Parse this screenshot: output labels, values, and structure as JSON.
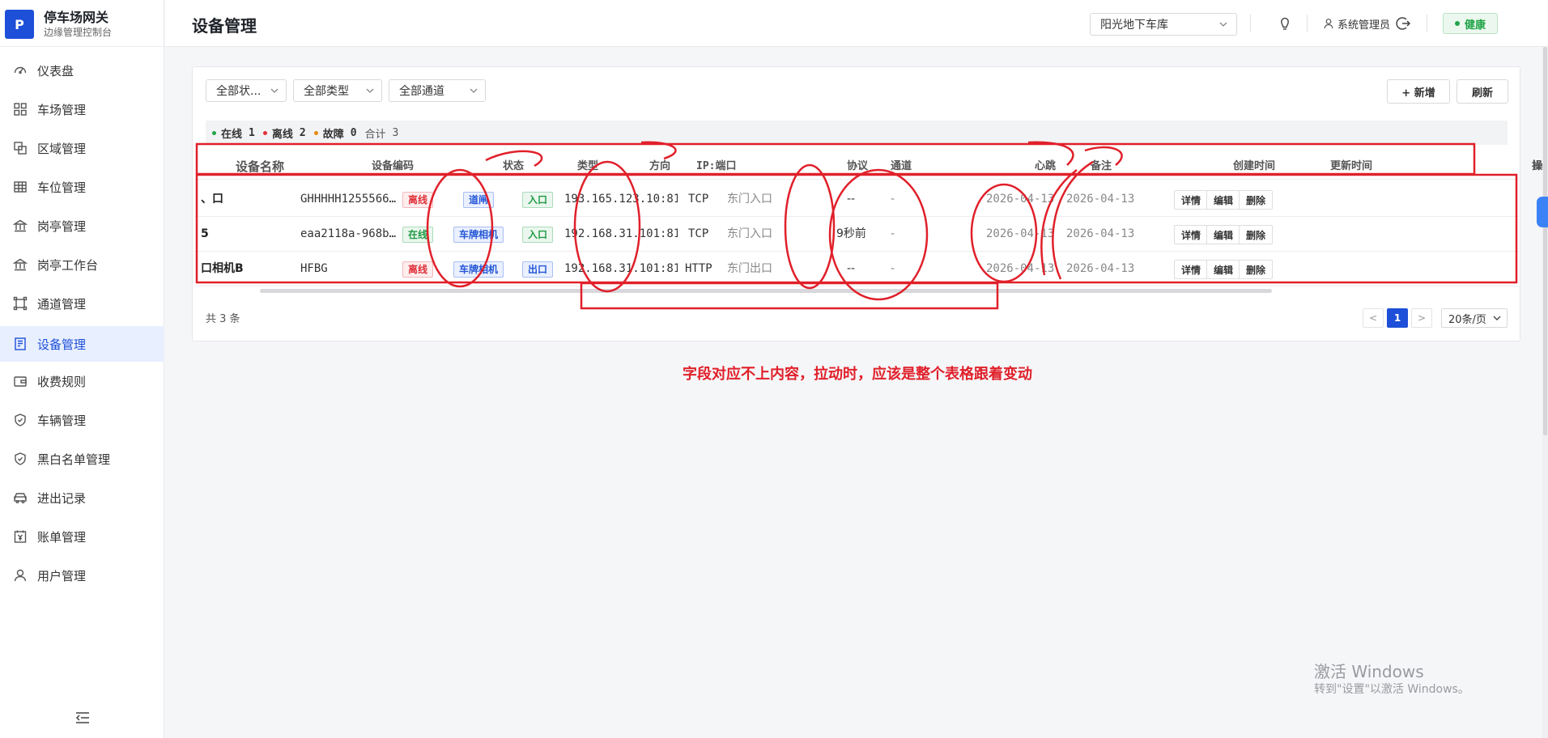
{
  "brand": {
    "logo_letter": "P",
    "title": "停车场网关",
    "subtitle": "边缘管理控制台"
  },
  "sidebar": {
    "items": [
      {
        "label": "仪表盘",
        "icon": "dashboard-icon"
      },
      {
        "label": "车场管理",
        "icon": "grid-icon"
      },
      {
        "label": "区域管理",
        "icon": "area-icon"
      },
      {
        "label": "车位管理",
        "icon": "table-icon"
      },
      {
        "label": "岗亭管理",
        "icon": "booth-icon"
      },
      {
        "label": "岗亭工作台",
        "icon": "booth-icon"
      },
      {
        "label": "通道管理",
        "icon": "channel-icon"
      },
      {
        "label": "设备管理",
        "icon": "device-icon",
        "active": true
      },
      {
        "label": "收费规则",
        "icon": "wallet-icon"
      },
      {
        "label": "车辆管理",
        "icon": "shield-icon"
      },
      {
        "label": "黑白名单管理",
        "icon": "shield-icon"
      },
      {
        "label": "进出记录",
        "icon": "car-icon"
      },
      {
        "label": "账单管理",
        "icon": "bill-icon"
      },
      {
        "label": "用户管理",
        "icon": "user-icon"
      }
    ]
  },
  "header": {
    "page_title": "设备管理",
    "lot_select": "阳光地下车库",
    "user_name": "系统管理员",
    "health_label": "健康"
  },
  "filters": {
    "status": "全部状...",
    "type": "全部类型",
    "channel": "全部通道"
  },
  "toolbar": {
    "add_label": "+ 新增",
    "refresh_label": "刷新"
  },
  "stats": {
    "online_label": "在线",
    "online_count": "1",
    "offline_label": "离线",
    "offline_count": "2",
    "fault_label": "故障",
    "fault_count": "0",
    "total_label": "合计",
    "total_count": "3"
  },
  "table": {
    "columns": {
      "name": "设备名称",
      "code": "设备编码",
      "status": "状态",
      "type": "类型",
      "direction": "方向",
      "ip": "IP:端口",
      "protocol": "协议",
      "channel": "通道",
      "heartbeat": "心跳",
      "remark": "备注",
      "created": "创建时间",
      "updated": "更新时间",
      "ops_partial": "操"
    },
    "rows": [
      {
        "name": "、口",
        "code": "GHHHHH1255566…",
        "status": "离线",
        "status_color": "red",
        "type": "道闸",
        "direction": "入口",
        "direction_color": "green",
        "ip": "193.165.123.10:81…",
        "protocol": "TCP",
        "channel": "东门入口",
        "heartbeat": "--",
        "remark": "-",
        "created": "2026-04-13 …",
        "updated": "2026-04-13 …"
      },
      {
        "name": "5",
        "code": "eaa2118a-968b…",
        "status": "在线",
        "status_color": "green",
        "type": "车牌相机",
        "direction": "入口",
        "direction_color": "green",
        "ip": "192.168.31.101:81…",
        "protocol": "TCP",
        "channel": "东门入口",
        "heartbeat": "9秒前",
        "remark": "-",
        "created": "2026-04-13 …",
        "updated": "2026-04-13 …"
      },
      {
        "name": "口相机B",
        "code": "HFBG",
        "status": "离线",
        "status_color": "red",
        "type": "车牌相机",
        "direction": "出口",
        "direction_color": "blue",
        "ip": "192.168.31.101:81…",
        "protocol": "HTTP",
        "channel": "东门出口",
        "heartbeat": "--",
        "remark": "-",
        "created": "2026-04-13 …",
        "updated": "2026-04-13 …"
      }
    ],
    "ops": {
      "detail": "详情",
      "edit": "编辑",
      "delete": "删除"
    }
  },
  "pagination": {
    "total_text": "共 3 条",
    "prev": "<",
    "current": "1",
    "next": ">",
    "page_size": "20条/页"
  },
  "annotation": {
    "note": "字段对应不上内容，拉动时，应该是整个表格跟着变动",
    "color": "#e0202a"
  },
  "watermark": {
    "line1": "激活 Windows",
    "line2": "转到\"设置\"以激活 Windows。"
  },
  "colors": {
    "primary": "#1d4fd8",
    "online": "#22a448",
    "offline": "#e0303a",
    "fault": "#e8890c"
  }
}
